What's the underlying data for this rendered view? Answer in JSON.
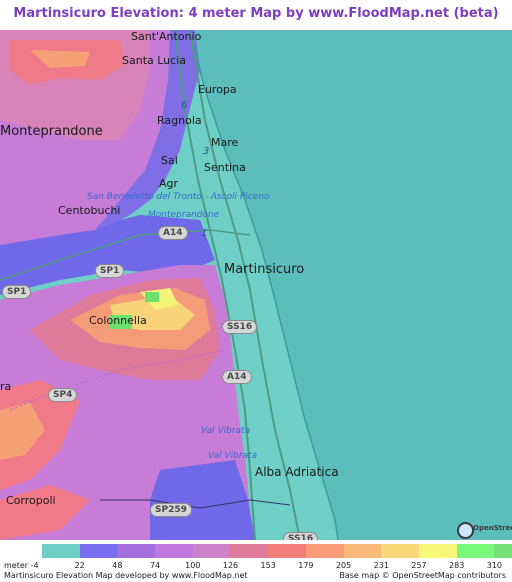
{
  "title": "Martinsicuro Elevation: 4 meter Map by www.FloodMap.net (beta)",
  "map": {
    "places": [
      {
        "name": "Sant'Antonio"
      },
      {
        "name": "Santa Lucia"
      },
      {
        "name": "Europa"
      },
      {
        "name": "Monteprandone"
      },
      {
        "name": "Ragnola"
      },
      {
        "name": "Mare"
      },
      {
        "name": "Sentina"
      },
      {
        "name": "Sal"
      },
      {
        "name": "Agr"
      },
      {
        "name": "Centobuchi"
      },
      {
        "name": "Martinsicuro"
      },
      {
        "name": "Colonnella"
      },
      {
        "name": "Alba Adriatica"
      },
      {
        "name": "Corropoli"
      },
      {
        "name": "ra"
      }
    ],
    "blue_labels": [
      {
        "text": "San Benedetto del Tronto - Ascoli Piceno"
      },
      {
        "text": "Monteprandone"
      },
      {
        "text": "Val Vibrata"
      },
      {
        "text": "Val Vibrata"
      }
    ],
    "road_shields": [
      "A14",
      "SP1",
      "SP1",
      "SS16",
      "A14",
      "SP4",
      "SP259",
      "SS16"
    ],
    "road_numbers": [
      "6",
      "3",
      "1"
    ],
    "osm_logo_text": "OpenStreetMap"
  },
  "legend": {
    "unit_label": "meter",
    "values": [
      "-4",
      "22",
      "48",
      "74",
      "100",
      "126",
      "153",
      "179",
      "205",
      "231",
      "257",
      "283",
      "310"
    ],
    "colors": [
      "#6ecfc6",
      "#7a6ef0",
      "#a56ee0",
      "#c07ae0",
      "#cc82c8",
      "#e07a9a",
      "#f47c78",
      "#f89a78",
      "#f8b878",
      "#f8d878",
      "#f8f878",
      "#78f878",
      "#78e078"
    ]
  },
  "footer": {
    "left": "Martinsicuro Elevation Map developed by www.FloodMap.net",
    "right": "Base map © OpenStreetMap contributors"
  },
  "colors": {
    "sea": "#5cbdbd",
    "low_land": "#6ecfc6",
    "title": "#7b3fc0"
  }
}
